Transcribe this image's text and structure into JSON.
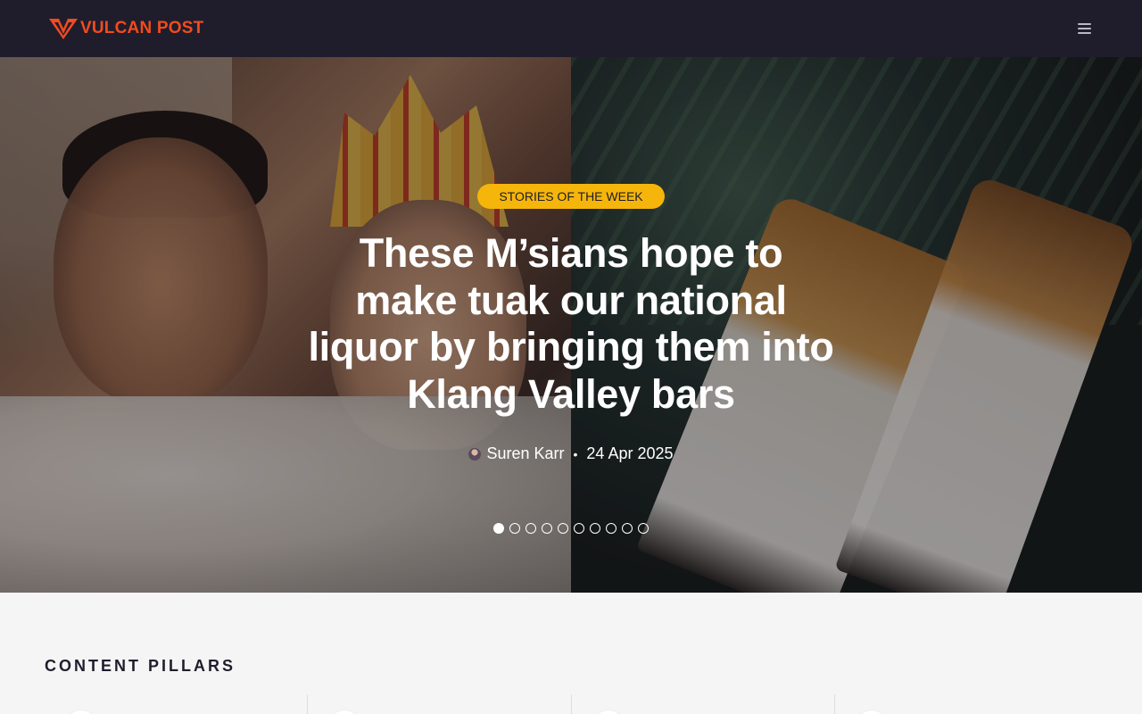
{
  "header": {
    "logo_text": "VULCAN POST",
    "brand_color": "#f24b1f",
    "menu_icon": "hamburger-menu-icon"
  },
  "hero": {
    "tag": "STORIES OF THE WEEK",
    "title": "These M’sians hope to make tuak our national liquor by bringing them into Klang Valley bars",
    "author": "Suren Karr",
    "separator": "•",
    "date": "24 Apr 2025",
    "slide_count": 10,
    "active_slide": 1,
    "tag_color": "#f5b50b"
  },
  "pillars": {
    "heading": "CONTENT PILLARS"
  }
}
